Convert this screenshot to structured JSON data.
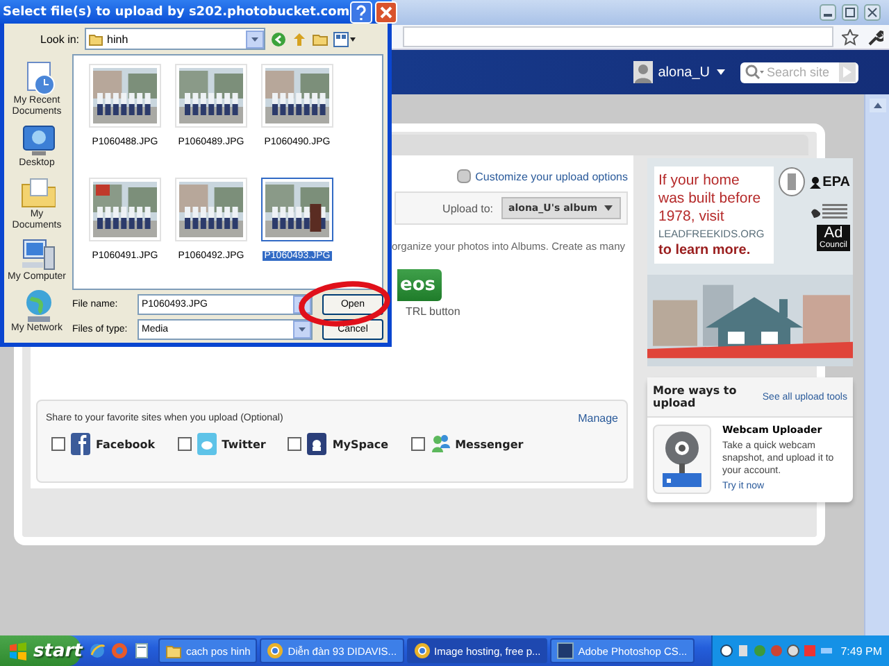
{
  "dialog": {
    "title": "Select file(s) to upload by s202.photobucket.com",
    "look_in_label": "Look in:",
    "look_in_value": "hinh",
    "places": [
      {
        "label": "My Recent Documents",
        "kind": "recent"
      },
      {
        "label": "Desktop",
        "kind": "desktop"
      },
      {
        "label": "My Documents",
        "kind": "documents"
      },
      {
        "label": "My Computer",
        "kind": "computer"
      },
      {
        "label": "My Network",
        "kind": "network"
      }
    ],
    "files": [
      {
        "name": "P1060488.JPG",
        "selected": false
      },
      {
        "name": "P1060489.JPG",
        "selected": false
      },
      {
        "name": "P1060490.JPG",
        "selected": false
      },
      {
        "name": "P1060491.JPG",
        "selected": false
      },
      {
        "name": "P1060492.JPG",
        "selected": false
      },
      {
        "name": "P1060493.JPG",
        "selected": true
      }
    ],
    "file_name_label": "File name:",
    "file_name_value": "P1060493.JPG",
    "file_type_label": "Files of type:",
    "file_type_value": "Media",
    "buttons": [
      "Open",
      "Cancel"
    ]
  },
  "header": {
    "username": "alona_U",
    "search_placeholder": "Search site"
  },
  "upload": {
    "customize_link": "Customize your upload options",
    "upload_to_label": "Upload to:",
    "album": "alona_U's album",
    "description": "organize your photos into Albums. Create as many",
    "button_text": "eos",
    "hint": "TRL button"
  },
  "share": {
    "title": "Share to your favorite sites when you upload (Optional)",
    "manage": "Manage",
    "sites": [
      {
        "name": "Facebook",
        "checked": false,
        "kind": "facebook"
      },
      {
        "name": "Twitter",
        "checked": false,
        "kind": "twitter"
      },
      {
        "name": "MySpace",
        "checked": false,
        "kind": "myspace"
      },
      {
        "name": "Messenger",
        "checked": false,
        "kind": "messenger"
      }
    ]
  },
  "ad": {
    "lines": [
      "If your home",
      "was built before",
      "1978, visit"
    ],
    "url": "LEADFREEKIDS.ORG",
    "cta": "to learn more.",
    "logo": "EPA",
    "ad_logo": [
      "Ad",
      "Council"
    ]
  },
  "more_ways": {
    "title": "More ways to upload",
    "link": "See all upload tools",
    "tool_title": "Webcam Uploader",
    "tool_desc": "Take a quick webcam snapshot, and upload it to your account.",
    "tool_link": "Try it now"
  },
  "taskbar": {
    "start": "start",
    "tasks": [
      {
        "label": "cach pos hinh",
        "selected": false,
        "kind": "folder"
      },
      {
        "label": "Diễn đàn 93 DIDAVIS...",
        "selected": false,
        "kind": "browser"
      },
      {
        "label": "Image hosting, free p...",
        "selected": true,
        "kind": "browser"
      },
      {
        "label": "Adobe Photoshop CS...",
        "selected": false,
        "kind": "app"
      }
    ],
    "clock": "7:49 PM"
  }
}
